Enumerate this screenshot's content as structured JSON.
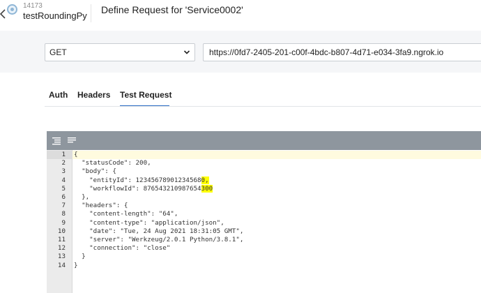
{
  "header": {
    "app_id": "14173",
    "app_name": "testRoundingPy",
    "page_title": "Define Request for 'Service0002'"
  },
  "request": {
    "method": "GET",
    "url": "https://0fd7-2405-201-c00f-4bdc-b807-4d71-e034-3fa9.ngrok.io"
  },
  "tabs": [
    {
      "label": "Auth",
      "active": false
    },
    {
      "label": "Headers",
      "active": false
    },
    {
      "label": "Test Request",
      "active": true
    }
  ],
  "editor": {
    "toolbar_icons": [
      "format-icon",
      "compact-icon"
    ],
    "highlight_color": "#ffff00",
    "lines": [
      {
        "num": "1",
        "text": "{"
      },
      {
        "num": "2",
        "text": "  \"statusCode\": 200,"
      },
      {
        "num": "3",
        "text": "  \"body\": {"
      },
      {
        "num": "4",
        "text": "    \"entityId\": 12345678901234568",
        "highlight": "0,"
      },
      {
        "num": "5",
        "text": "    \"workflowId\": 876543210987654",
        "highlight": "300"
      },
      {
        "num": "6",
        "text": "  },"
      },
      {
        "num": "7",
        "text": "  \"headers\": {"
      },
      {
        "num": "8",
        "text": "    \"content-length\": \"64\","
      },
      {
        "num": "9",
        "text": "    \"content-type\": \"application/json\","
      },
      {
        "num": "10",
        "text": "    \"date\": \"Tue, 24 Aug 2021 18:31:05 GMT\","
      },
      {
        "num": "11",
        "text": "    \"server\": \"Werkzeug/2.0.1 Python/3.8.1\","
      },
      {
        "num": "12",
        "text": "    \"connection\": \"close\""
      },
      {
        "num": "13",
        "text": "  }"
      },
      {
        "num": "14",
        "text": "}"
      }
    ]
  }
}
